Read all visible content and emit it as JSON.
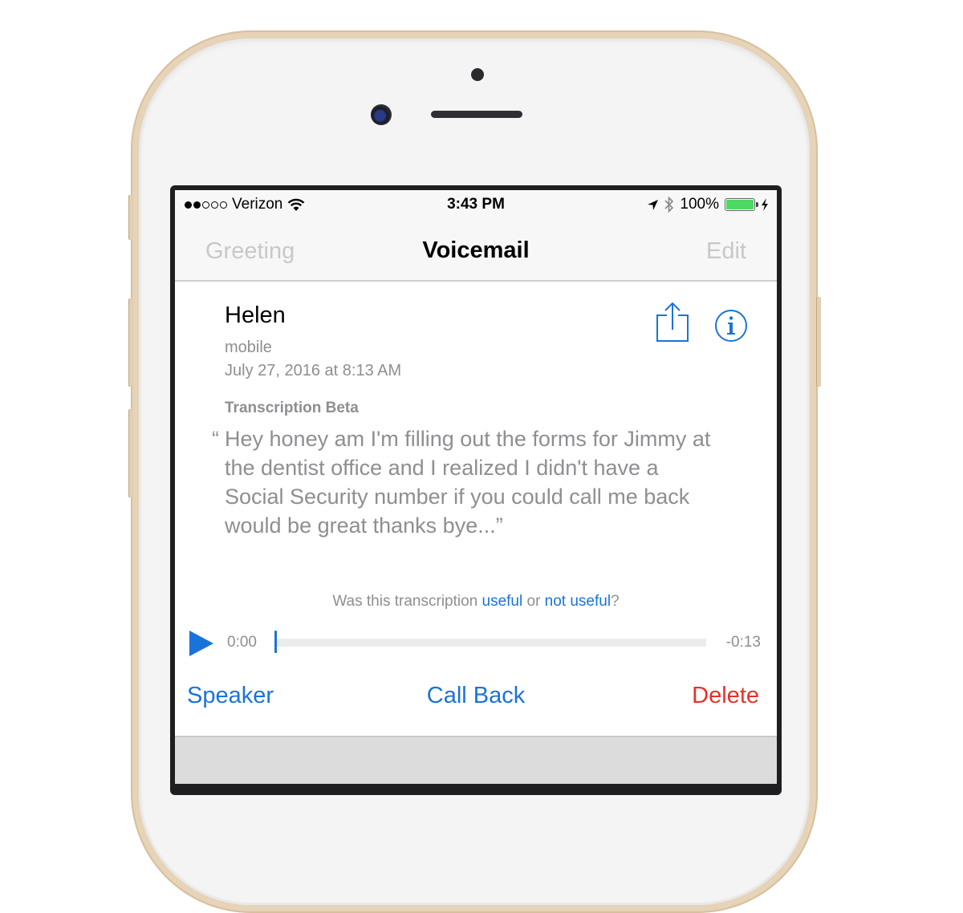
{
  "status_bar": {
    "signal_strength": {
      "filled": 2,
      "total": 5
    },
    "carrier": "Verizon",
    "wifi_icon": "wifi-icon",
    "time": "3:43 PM",
    "location_icon": "location-arrow-icon",
    "bluetooth_icon": "bluetooth-icon",
    "battery_percent": "100%",
    "battery_level": 1.0,
    "charging_icon": "bolt-icon",
    "battery_color": "#4cd964"
  },
  "nav": {
    "left_label": "Greeting",
    "title": "Voicemail",
    "right_label": "Edit"
  },
  "voicemail": {
    "caller_name": "Helen",
    "caller_type": "mobile",
    "date": "July 27, 2016 at 8:13 AM",
    "share_icon": "share-icon",
    "info_icon": "info-icon",
    "transcription_label": "Transcription Beta",
    "transcription_open_quote": "“",
    "transcription_text": "Hey honey am I'm filling out the forms for Jimmy at the dentist office and I realized I didn't have a Social Security number if you could call me back would be great thanks bye...”",
    "feedback": {
      "prefix": "Was this transcription ",
      "useful": "useful",
      "or": " or ",
      "not_useful": "not useful",
      "suffix": "?"
    }
  },
  "player": {
    "play_icon": "play-icon",
    "elapsed": "0:00",
    "remaining": "-0:13",
    "progress": 0.0
  },
  "actions": {
    "speaker": "Speaker",
    "call_back": "Call Back",
    "delete": "Delete"
  },
  "colors": {
    "accent": "#1a73d9",
    "destructive": "#e8302a",
    "secondary_text": "#8e8e93"
  }
}
